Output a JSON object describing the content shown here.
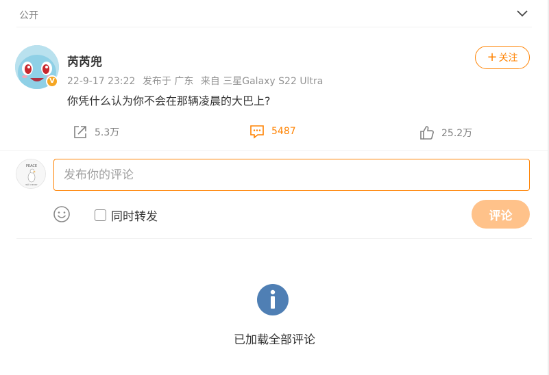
{
  "header": {
    "visibility": "公开",
    "chevron_icon": "chevron-down-icon"
  },
  "post": {
    "username": "芮芮兜",
    "verified_badge": "V",
    "datetime": "22-9-17 23:22",
    "location": "发布于 广东",
    "source": "来自 三星Galaxy S22 Ultra",
    "text": "你凭什么认为你不会在那辆凌晨的大巴上?",
    "follow_label": "关注",
    "follow_icon": "plus-icon",
    "accent_color": "#ff8200"
  },
  "actions": {
    "repost_count": "5.3万",
    "comment_count": "5487",
    "like_count": "25.2万",
    "repost_icon": "share-icon",
    "comment_icon": "comment-icon",
    "like_icon": "thumbs-up-icon"
  },
  "composer": {
    "placeholder": "发布你的评论",
    "value": "",
    "emoji_icon": "smiley-icon",
    "repost_label": "同时转发",
    "repost_checked": false,
    "submit_label": "评论",
    "submit_color": "#ffc28a"
  },
  "footer": {
    "info_icon": "info-icon",
    "info_color": "#4f7fb4",
    "end_text": "已加载全部评论"
  }
}
